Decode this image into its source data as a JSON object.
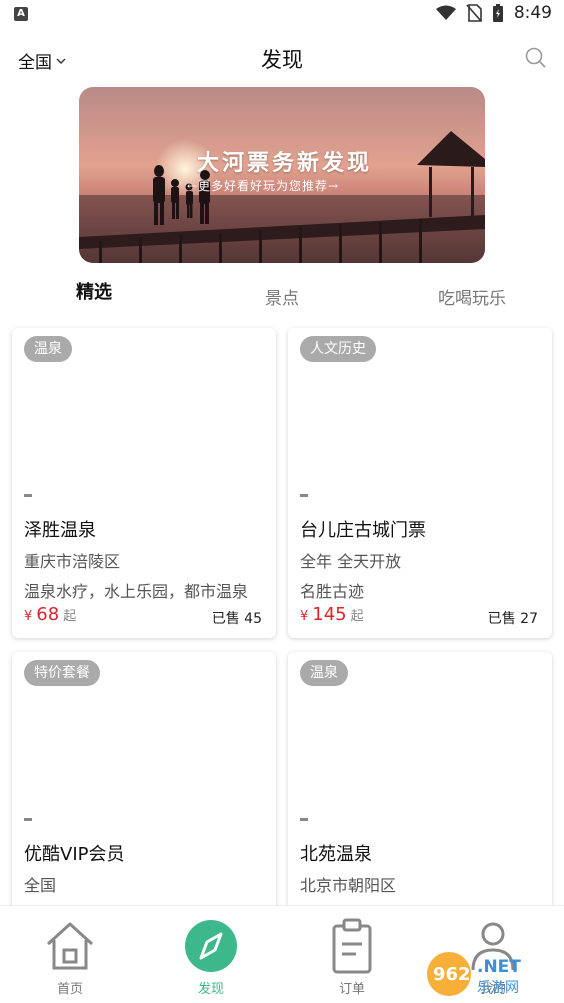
{
  "status_bar": {
    "time": "8:49"
  },
  "header": {
    "region": "全国",
    "title": "发现"
  },
  "banner": {
    "title": "大河票务新发现",
    "subtitle": "←更多好看好玩为您推荐→"
  },
  "tabs": [
    {
      "label": "精选",
      "active": true
    },
    {
      "label": "景点",
      "active": false
    },
    {
      "label": "吃喝玩乐",
      "active": false
    }
  ],
  "cards": [
    {
      "tag": "温泉",
      "name": "泽胜温泉",
      "line1": "重庆市涪陵区",
      "line2": "温泉水疗，水上乐园，都市温泉",
      "currency": "¥",
      "price": "68",
      "price_suffix": "起",
      "sold": "已售 45"
    },
    {
      "tag": "人文历史",
      "name": "台儿庄古城门票",
      "line1": "全年 全天开放",
      "line2": "名胜古迹",
      "currency": "¥",
      "price": "145",
      "price_suffix": "起",
      "sold": "已售 27"
    },
    {
      "tag": "特价套餐",
      "name": "优酷VIP会员",
      "line1": "全国",
      "line2": "",
      "currency": "",
      "price": "",
      "price_suffix": "",
      "sold": ""
    },
    {
      "tag": "温泉",
      "name": "北苑温泉",
      "line1": "北京市朝阳区",
      "line2": "",
      "currency": "",
      "price": "",
      "price_suffix": "",
      "sold": ""
    }
  ],
  "bottom_nav": [
    {
      "label": "首页",
      "icon": "home-icon",
      "active": false
    },
    {
      "label": "发现",
      "icon": "compass-icon",
      "active": true
    },
    {
      "label": "订单",
      "icon": "clipboard-icon",
      "active": false
    },
    {
      "label": "我的",
      "icon": "user-icon",
      "active": false
    }
  ],
  "watermark": {
    "text": "962.NET",
    "sub": "乐游网"
  },
  "colors": {
    "accent": "#3db88a",
    "price": "#e0242a",
    "badge": "#aaaaaa"
  }
}
